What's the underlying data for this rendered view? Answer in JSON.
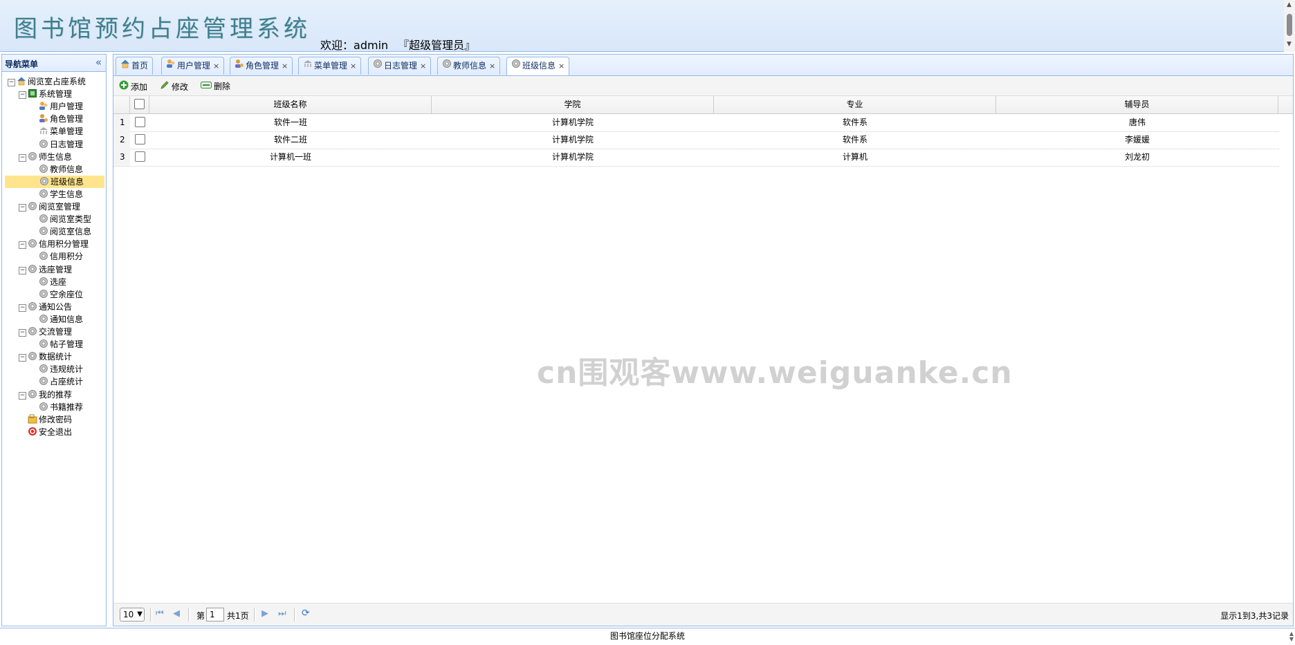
{
  "header": {
    "app_title": "图书馆预约占座管理系统",
    "welcome_prefix": "欢迎：",
    "username": "admin",
    "role": "『超级管理员』"
  },
  "nav": {
    "title": "导航菜单",
    "tree": [
      {
        "label": "阅览室占座系统",
        "icon": "home-icon",
        "toggle": "−",
        "level": 0
      },
      {
        "label": "系统管理",
        "icon": "folder-green-icon",
        "toggle": "−",
        "level": 1
      },
      {
        "label": "用户管理",
        "icon": "users-icon",
        "level": 2
      },
      {
        "label": "角色管理",
        "icon": "role-icon",
        "level": 2
      },
      {
        "label": "菜单管理",
        "icon": "menu-icon",
        "level": 2
      },
      {
        "label": "日志管理",
        "icon": "gear-icon",
        "level": 2
      },
      {
        "label": "师生信息",
        "icon": "gear-icon",
        "toggle": "−",
        "level": 1
      },
      {
        "label": "教师信息",
        "icon": "gear-icon",
        "level": 2
      },
      {
        "label": "班级信息",
        "icon": "gear-icon",
        "level": 2,
        "selected": true
      },
      {
        "label": "学生信息",
        "icon": "gear-icon",
        "level": 2
      },
      {
        "label": "阅览室管理",
        "icon": "gear-icon",
        "toggle": "−",
        "level": 1
      },
      {
        "label": "阅览室类型",
        "icon": "gear-icon",
        "level": 2
      },
      {
        "label": "阅览室信息",
        "icon": "gear-icon",
        "level": 2
      },
      {
        "label": "信用积分管理",
        "icon": "gear-icon",
        "toggle": "−",
        "level": 1
      },
      {
        "label": "信用积分",
        "icon": "gear-icon",
        "level": 2
      },
      {
        "label": "选座管理",
        "icon": "gear-icon",
        "toggle": "−",
        "level": 1
      },
      {
        "label": "选座",
        "icon": "gear-icon",
        "level": 2
      },
      {
        "label": "空余座位",
        "icon": "gear-icon",
        "level": 2
      },
      {
        "label": "通知公告",
        "icon": "gear-icon",
        "toggle": "−",
        "level": 1
      },
      {
        "label": "通知信息",
        "icon": "gear-icon",
        "level": 2
      },
      {
        "label": "交流管理",
        "icon": "gear-icon",
        "toggle": "−",
        "level": 1
      },
      {
        "label": "帖子管理",
        "icon": "gear-icon",
        "level": 2
      },
      {
        "label": "数据统计",
        "icon": "gear-icon",
        "toggle": "−",
        "level": 1
      },
      {
        "label": "违规统计",
        "icon": "gear-icon",
        "level": 2
      },
      {
        "label": "占座统计",
        "icon": "gear-icon",
        "level": 2
      },
      {
        "label": "我的推荐",
        "icon": "gear-icon",
        "toggle": "−",
        "level": 1
      },
      {
        "label": "书籍推荐",
        "icon": "gear-icon",
        "level": 2
      },
      {
        "label": "修改密码",
        "icon": "password-icon",
        "level": 1
      },
      {
        "label": "安全退出",
        "icon": "exit-icon",
        "level": 1
      }
    ]
  },
  "tabs": [
    {
      "label": "首页",
      "icon": "home-icon",
      "closable": false
    },
    {
      "label": "用户管理",
      "icon": "users-icon",
      "closable": true
    },
    {
      "label": "角色管理",
      "icon": "role-icon",
      "closable": true
    },
    {
      "label": "菜单管理",
      "icon": "menu-icon",
      "closable": true
    },
    {
      "label": "日志管理",
      "icon": "gear-icon",
      "closable": true
    },
    {
      "label": "教师信息",
      "icon": "gear-icon",
      "closable": true
    },
    {
      "label": "班级信息",
      "icon": "gear-icon",
      "closable": true,
      "active": true
    }
  ],
  "toolbar": {
    "add_label": "添加",
    "edit_label": "修改",
    "delete_label": "删除"
  },
  "grid": {
    "columns": [
      "班级名称",
      "学院",
      "专业",
      "辅导员"
    ],
    "rows": [
      {
        "num": "1",
        "cells": [
          "软件一班",
          "计算机学院",
          "软件系",
          "唐伟"
        ]
      },
      {
        "num": "2",
        "cells": [
          "软件二班",
          "计算机学院",
          "软件系",
          "李媛媛"
        ]
      },
      {
        "num": "3",
        "cells": [
          "计算机一班",
          "计算机学院",
          "计算机",
          "刘龙初"
        ]
      }
    ]
  },
  "watermark": "cn围观客www.weiguanke.cn",
  "pager": {
    "page_size": "10",
    "page_prefix": "第",
    "page_value": "1",
    "page_total": "共1页",
    "info": "显示1到3,共3记录"
  },
  "footer": {
    "text": "图书馆座位分配系统"
  },
  "colors": {
    "accent_border": "#95b8e7",
    "header_bg": "#dbe8fb",
    "selected_bg": "#ffe48d"
  }
}
